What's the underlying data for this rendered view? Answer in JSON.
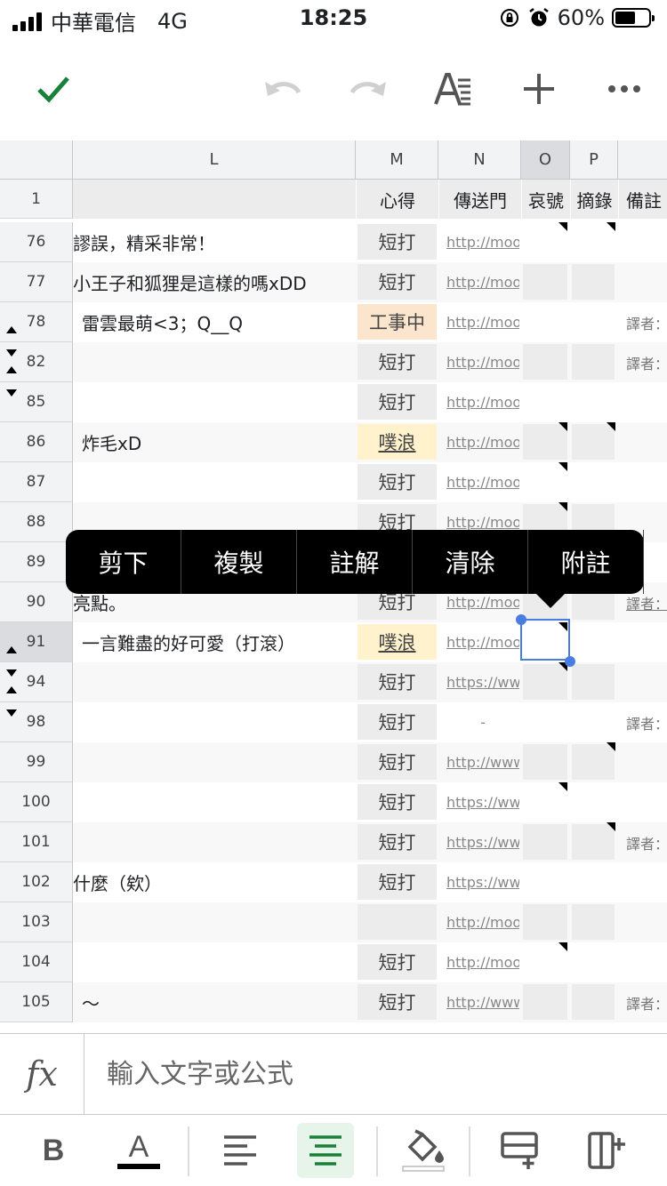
{
  "status_bar": {
    "carrier": "中華電信",
    "network": "4G",
    "time": "18:25",
    "battery": "60%",
    "battery_level": 0.6
  },
  "toolbar": {
    "icons": [
      "check-icon",
      "undo-icon",
      "redo-icon",
      "text-format-icon",
      "plus-icon",
      "more-icon"
    ],
    "accent": "#188038"
  },
  "columns": [
    {
      "letter": "L",
      "header": ""
    },
    {
      "letter": "M",
      "header": "心得"
    },
    {
      "letter": "N",
      "header": "傳送門"
    },
    {
      "letter": "O",
      "header": "哀號"
    },
    {
      "letter": "P",
      "header": "摘錄"
    },
    {
      "letter": "",
      "header": "備註"
    }
  ],
  "header_row_number": "1",
  "rows": [
    {
      "num": "76",
      "l": "謬誤，精采非常！",
      "m": "短打",
      "n": "http://moo",
      "q": "",
      "ind": "",
      "noteO": true,
      "noteP": true
    },
    {
      "num": "77",
      "l": "小王子和狐狸是這樣的嗎xDD",
      "m": "短打",
      "n": "http://moo",
      "q": "",
      "ind": "",
      "noteO": false,
      "noteP": false
    },
    {
      "num": "78",
      "l": "雷雲最萌<3；Q__Q",
      "m": "工事中",
      "n": "http://moo",
      "q": "譯者：",
      "ind": "up",
      "noteO": false,
      "noteP": false
    },
    {
      "num": "82",
      "l": "",
      "m": "短打",
      "n": "http://moo",
      "q": "譯者：",
      "ind": "both",
      "noteO": false,
      "noteP": false
    },
    {
      "num": "85",
      "l": "",
      "m": "短打",
      "n": "http://moo",
      "q": "",
      "ind": "down",
      "noteO": false,
      "noteP": false
    },
    {
      "num": "86",
      "l": "炸毛xD",
      "m": "噗浪",
      "n": "http://moo",
      "q": "",
      "ind": "",
      "noteO": true,
      "noteP": true
    },
    {
      "num": "87",
      "l": "",
      "m": "短打",
      "n": "http://moo",
      "q": "",
      "ind": "",
      "noteO": true,
      "noteP": false
    },
    {
      "num": "88",
      "l": "",
      "m": "短打",
      "n": "http://moo",
      "q": "",
      "ind": "",
      "noteO": true,
      "noteP": false
    },
    {
      "num": "89",
      "l": "",
      "m": "",
      "n": "",
      "q": "",
      "ind": "",
      "noteO": false,
      "noteP": false
    },
    {
      "num": "90",
      "l": "亮點。",
      "m": "短打",
      "n": "http://moo",
      "q": "譯者：",
      "ind": "",
      "noteO": false,
      "noteP": false
    },
    {
      "num": "91",
      "l": "一言難盡的好可愛（打滾）",
      "m": "噗浪",
      "n": "http://moo",
      "q": "",
      "ind": "up",
      "noteO": true,
      "noteP": false
    },
    {
      "num": "94",
      "l": "",
      "m": "短打",
      "n": "https://ww",
      "q": "",
      "ind": "both",
      "noteO": true,
      "noteP": false
    },
    {
      "num": "98",
      "l": "",
      "m": "短打",
      "n": "-",
      "q": "譯者：",
      "ind": "down",
      "noteO": false,
      "noteP": false
    },
    {
      "num": "99",
      "l": "",
      "m": "短打",
      "n": "http://www",
      "q": "",
      "ind": "",
      "noteO": false,
      "noteP": true
    },
    {
      "num": "100",
      "l": "",
      "m": "短打",
      "n": "https://ww",
      "q": "",
      "ind": "",
      "noteO": true,
      "noteP": false
    },
    {
      "num": "101",
      "l": "",
      "m": "短打",
      "n": "https://ww",
      "q": "譯者：",
      "ind": "",
      "noteO": false,
      "noteP": true
    },
    {
      "num": "102",
      "l": "什麼（欸）",
      "m": "短打",
      "n": "https://ww",
      "q": "",
      "ind": "",
      "noteO": false,
      "noteP": false
    },
    {
      "num": "103",
      "l": "",
      "m": "",
      "n": "http://moo",
      "q": "",
      "ind": "",
      "noteO": false,
      "noteP": false
    },
    {
      "num": "104",
      "l": "",
      "m": "短打",
      "n": "http://moo",
      "q": "",
      "ind": "",
      "noteO": true,
      "noteP": false
    },
    {
      "num": "105",
      "l": "～",
      "m": "短打",
      "n": "http://www",
      "q": "譯者：",
      "ind": "",
      "noteO": false,
      "noteP": false
    }
  ],
  "context_menu": [
    "剪下",
    "複製",
    "註解",
    "清除",
    "附註"
  ],
  "formula_bar": {
    "fx_label": "fx",
    "placeholder": "輸入文字或公式"
  },
  "bottom_toolbar": {
    "bold_label": "B",
    "text_color_label": "A",
    "icons": [
      "bold-icon",
      "text-color-icon",
      "align-left-icon",
      "align-center-icon",
      "fill-color-icon",
      "insert-row-icon",
      "insert-column-icon"
    ],
    "active": "align-center-icon",
    "active_color": "#188038"
  }
}
